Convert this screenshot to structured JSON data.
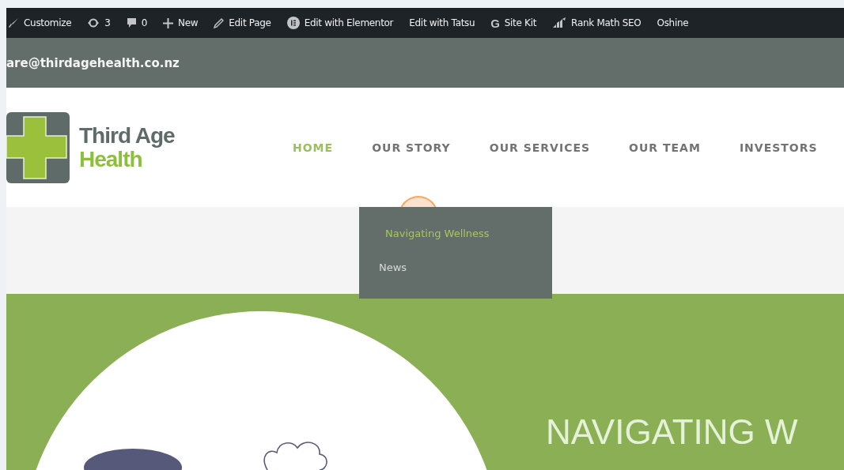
{
  "admin_bar": {
    "items": [
      {
        "kind": "brush",
        "label": "Customize"
      },
      {
        "kind": "refresh",
        "label": "3"
      },
      {
        "kind": "comment",
        "label": "0"
      },
      {
        "kind": "plus",
        "label": "New"
      },
      {
        "kind": "pencil",
        "label": "Edit Page"
      },
      {
        "kind": "elementor",
        "label": "Edit with Elementor"
      },
      {
        "kind": "text",
        "label": "Edit with Tatsu"
      },
      {
        "kind": "glyph",
        "glyph": "G",
        "label": "Site Kit"
      },
      {
        "kind": "chart",
        "label": "Rank Math SEO"
      },
      {
        "kind": "text",
        "label": "Oshine"
      }
    ]
  },
  "top_bar": {
    "email": "are@thirdagehealth.co.nz"
  },
  "logo": {
    "line_1": "Third Age",
    "line_2": "Health"
  },
  "nav": [
    {
      "label": "HOME",
      "selected": true
    },
    {
      "label": "OUR STORY",
      "selected": false
    },
    {
      "label": "OUR SERVICES",
      "selected": false
    },
    {
      "label": "OUR TEAM",
      "selected": false
    },
    {
      "label": "INVESTORS",
      "selected": false
    }
  ],
  "dropdown": [
    {
      "label": "Navigating Wellness",
      "selected": true
    },
    {
      "label": "News",
      "selected": false
    }
  ],
  "hero": {
    "title": "NAVIGATING W"
  }
}
